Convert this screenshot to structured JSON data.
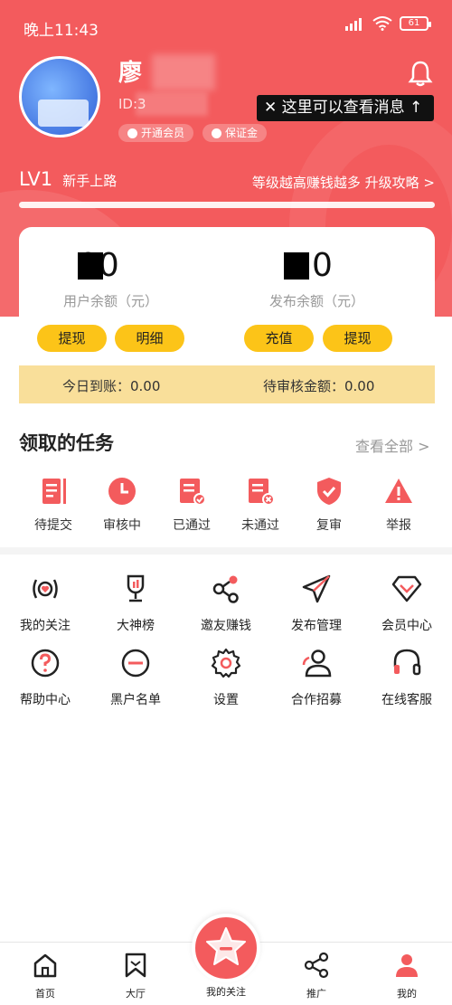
{
  "status_bar": {
    "time": "晚上11:43",
    "battery": "61"
  },
  "profile": {
    "name": "廖",
    "id_prefix": "ID:3",
    "tag_vip": "开通会员",
    "tag_deposit": "保证金",
    "message_tip": "✕ 这里可以查看消息 ↑"
  },
  "level": {
    "badge": "LV1",
    "name": "新手上路",
    "hint": "等级越高赚钱越多 升级攻略 >"
  },
  "wallet": {
    "user_amount": "00",
    "user_label": "用户余额（元）",
    "publish_amount": "0",
    "publish_label": "发布余额（元）",
    "buttons": [
      "提现",
      "明细",
      "充值",
      "提现"
    ],
    "today": "今日到账：0.00",
    "pending": "待审核金额：0.00"
  },
  "tasks": {
    "title": "领取的任务",
    "view_all": "查看全部 >",
    "items": [
      "待提交",
      "审核中",
      "已通过",
      "未通过",
      "复审",
      "举报"
    ]
  },
  "grid": {
    "row1": [
      "我的关注",
      "大神榜",
      "邀友赚钱",
      "发布管理",
      "会员中心"
    ],
    "row2": [
      "帮助中心",
      "黑户名单",
      "设置",
      "合作招募",
      "在线客服"
    ]
  },
  "nav": {
    "items": [
      "首页",
      "大厅",
      "我的关注",
      "推广",
      "我的"
    ]
  },
  "colors": {
    "accent": "#f35b5d",
    "pill": "#fcc418",
    "summary_bg": "#f9df9a"
  }
}
